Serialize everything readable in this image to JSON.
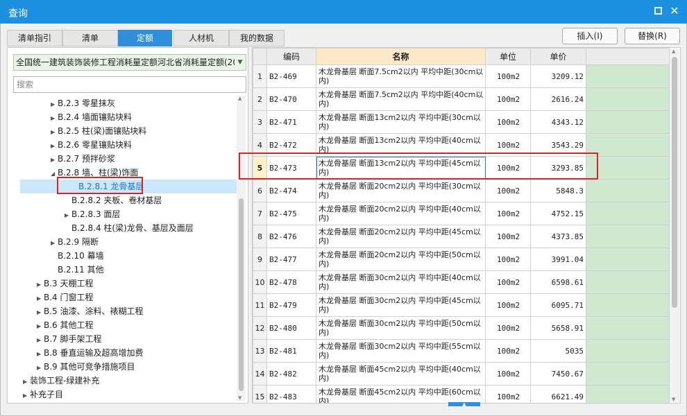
{
  "window": {
    "title": "查询"
  },
  "tabs": [
    {
      "label": "清单指引",
      "active": false
    },
    {
      "label": "清单",
      "active": false
    },
    {
      "label": "定额",
      "active": true
    },
    {
      "label": "人材机",
      "active": false
    },
    {
      "label": "我的数据",
      "active": false
    }
  ],
  "actions": {
    "insert_label": "插入(I)",
    "replace_label": "替换(R)"
  },
  "library": {
    "selected": "全国统一建筑装饰装修工程消耗量定额河北省消耗量定额(20"
  },
  "search": {
    "placeholder": "搜索"
  },
  "tree": [
    {
      "label": "B.2.3 零星抹灰",
      "arrow": "▶"
    },
    {
      "label": "B.2.4 墙面镶贴块料",
      "arrow": "▶"
    },
    {
      "label": "B.2.5 柱(梁)面镶贴块料",
      "arrow": "▶"
    },
    {
      "label": "B.2.6 零星镶贴块料",
      "arrow": "▶"
    },
    {
      "label": "B.2.7 预拌砂浆",
      "arrow": "▶"
    },
    {
      "label": "B.2.8 墙、柱(梁)饰面",
      "arrow": "◢"
    },
    {
      "label": "B.2.8.1 龙骨基层",
      "arrow": ""
    },
    {
      "label": "B.2.8.2 夹板、卷材基层",
      "arrow": ""
    },
    {
      "label": "B.2.8.3 面层",
      "arrow": "▶"
    },
    {
      "label": "B.2.8.4 柱(梁)龙骨、基层及面层",
      "arrow": ""
    },
    {
      "label": "B.2.9 隔断",
      "arrow": "▶"
    },
    {
      "label": "B.2.10 幕墙",
      "arrow": ""
    },
    {
      "label": "B.2.11 其他",
      "arrow": ""
    },
    {
      "label": "B.3 天棚工程",
      "arrow": "▶"
    },
    {
      "label": "B.4 门窗工程",
      "arrow": "▶"
    },
    {
      "label": "B.5 油漆、涂料、裱糊工程",
      "arrow": "▶"
    },
    {
      "label": "B.6 其他工程",
      "arrow": "▶"
    },
    {
      "label": "B.7 脚手架工程",
      "arrow": "▶"
    },
    {
      "label": "B.8 垂直运输及超高增加费",
      "arrow": "▶"
    },
    {
      "label": "B.9 其他可竞争措施项目",
      "arrow": "▶"
    },
    {
      "label": "装饰工程-绿建补充",
      "arrow": "▶"
    },
    {
      "label": "补充子目",
      "arrow": "▶"
    }
  ],
  "grid": {
    "headers": {
      "code": "编码",
      "name": "名称",
      "unit": "单位",
      "price": "单价"
    },
    "rows": [
      {
        "idx": "1",
        "code": "B2-469",
        "name": "木龙骨基层 断面7.5cm2以内 平均中距(30cm以内)",
        "unit": "100m2",
        "price": "3209.12"
      },
      {
        "idx": "2",
        "code": "B2-470",
        "name": "木龙骨基层 断面7.5cm2以内 平均中距(40cm以内)",
        "unit": "100m2",
        "price": "2616.24"
      },
      {
        "idx": "3",
        "code": "B2-471",
        "name": "木龙骨基层 断面13cm2以内 平均中距(30cm以内)",
        "unit": "100m2",
        "price": "4343.12"
      },
      {
        "idx": "4",
        "code": "B2-472",
        "name": "木龙骨基层 断面13cm2以内 平均中距(40cm以内)",
        "unit": "100m2",
        "price": "3543.29"
      },
      {
        "idx": "5",
        "code": "B2-473",
        "name": "木龙骨基层 断面13cm2以内 平均中距(45cm以内)",
        "unit": "100m2",
        "price": "3293.85"
      },
      {
        "idx": "6",
        "code": "B2-474",
        "name": "木龙骨基层 断面20cm2以内 平均中距(30cm以内)",
        "unit": "100m2",
        "price": "5848.3"
      },
      {
        "idx": "7",
        "code": "B2-475",
        "name": "木龙骨基层 断面20cm2以内 平均中距(40cm以内)",
        "unit": "100m2",
        "price": "4752.15"
      },
      {
        "idx": "8",
        "code": "B2-476",
        "name": "木龙骨基层 断面20cm2以内 平均中距(45cm以内)",
        "unit": "100m2",
        "price": "4373.85"
      },
      {
        "idx": "9",
        "code": "B2-477",
        "name": "木龙骨基层 断面20cm2以内 平均中距(50cm以内)",
        "unit": "100m2",
        "price": "3991.04"
      },
      {
        "idx": "10",
        "code": "B2-478",
        "name": "木龙骨基层 断面30cm2以内 平均中距(40cm以内)",
        "unit": "100m2",
        "price": "6598.61"
      },
      {
        "idx": "11",
        "code": "B2-479",
        "name": "木龙骨基层 断面30cm2以内 平均中距(45cm以内)",
        "unit": "100m2",
        "price": "6095.71"
      },
      {
        "idx": "12",
        "code": "B2-480",
        "name": "木龙骨基层 断面30cm2以内 平均中距(50cm以内)",
        "unit": "100m2",
        "price": "5658.91"
      },
      {
        "idx": "13",
        "code": "B2-481",
        "name": "木龙骨基层 断面30cm2以内 平均中距(55cm以内)",
        "unit": "100m2",
        "price": "5035"
      },
      {
        "idx": "14",
        "code": "B2-482",
        "name": "木龙骨基层 断面45cm2以内 平均中距(40cm以内)",
        "unit": "100m2",
        "price": "7450.67"
      },
      {
        "idx": "15",
        "code": "B2-483",
        "name": "木龙骨基层 断面45cm2以内 平均中距(60cm以内)",
        "unit": "100m2",
        "price": "6621.49"
      }
    ]
  },
  "colors": {
    "accent": "#1e90e0",
    "highlight": "#e02020",
    "green_column": "#cfe9d0",
    "name_header": "#fde8c8"
  }
}
